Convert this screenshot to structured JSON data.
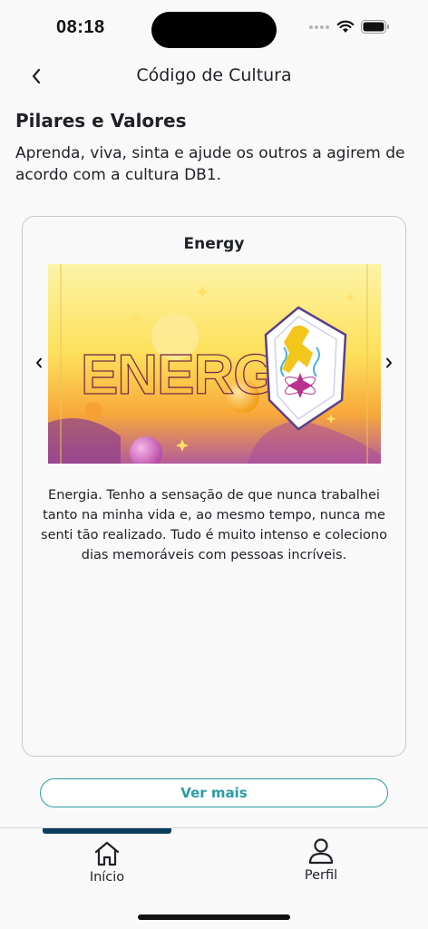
{
  "status": {
    "time": "08:18"
  },
  "header": {
    "title": "Código de Cultura",
    "back_icon": "chevron-left-icon"
  },
  "section": {
    "title": "Pilares e Valores",
    "description": "Aprenda, viva, sinta e ajude os outros a agirem de acordo com a cultura DB1."
  },
  "card": {
    "title": "Energy",
    "image_word": "ENERGY",
    "description": "Energia. Tenho a sensação de que nunca trabalhei tanto na minha vida e, ao mesmo tempo, nunca me senti tão realizado. Tudo é muito intenso e coleciono dias memoráveis com pessoas incríveis."
  },
  "actions": {
    "more_label": "Ver mais"
  },
  "tabs": [
    {
      "label": "Início",
      "icon": "home-icon",
      "active": true
    },
    {
      "label": "Perfil",
      "icon": "user-icon",
      "active": false
    }
  ],
  "colors": {
    "accent": "#2a9da4",
    "tab_indicator": "#0e3c5c",
    "text": "#1f2127"
  }
}
